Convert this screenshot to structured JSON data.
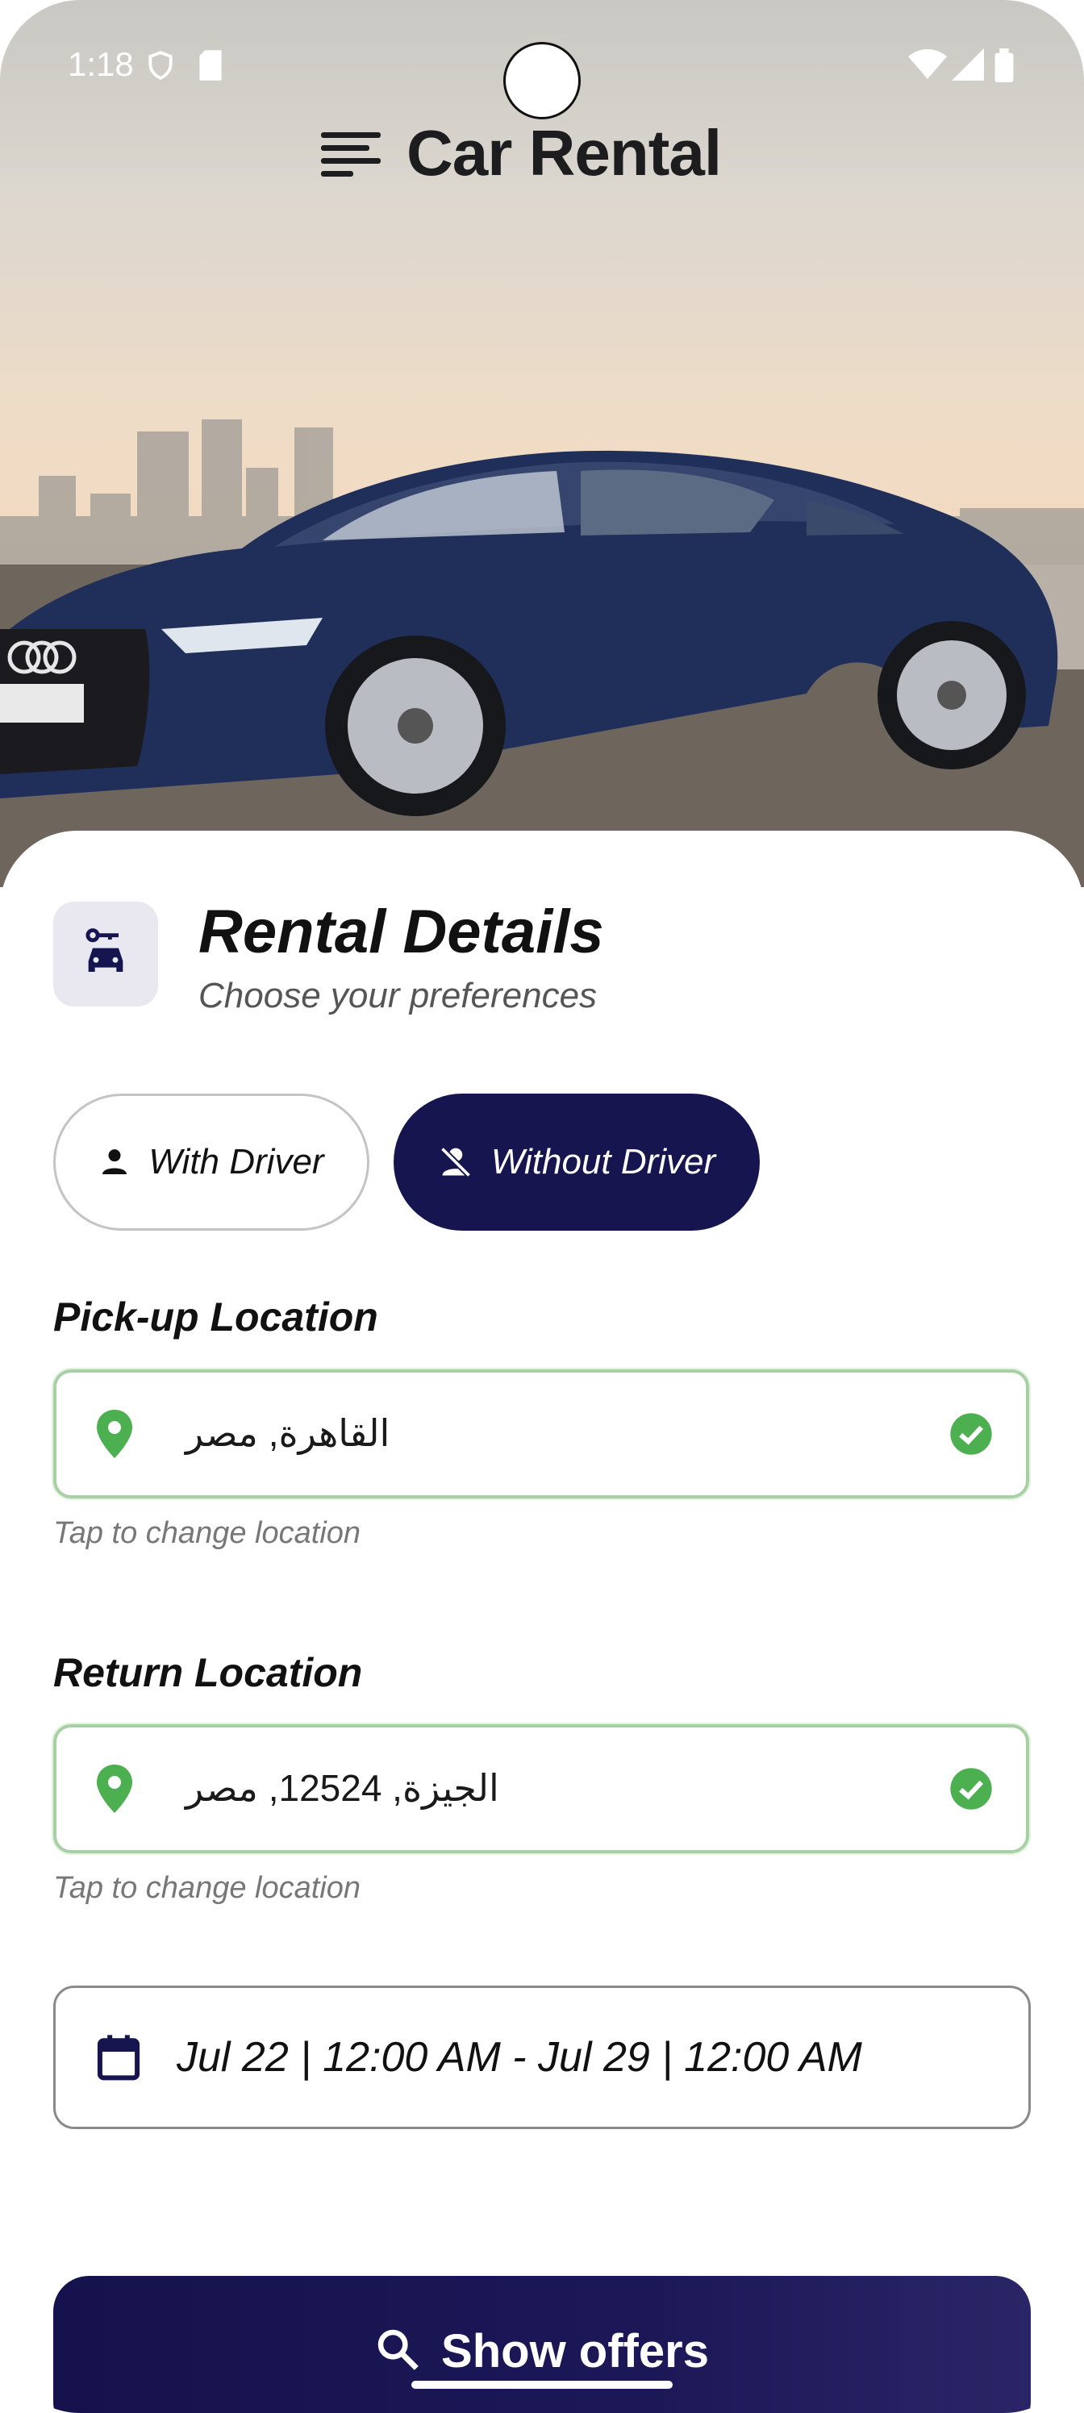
{
  "status_bar": {
    "time": "1:18"
  },
  "header": {
    "title": "Car Rental",
    "menu_icon": "menu-icon"
  },
  "hero": {
    "image": "car-photo"
  },
  "rental": {
    "title": "Rental Details",
    "subtitle": "Choose your preferences",
    "icon": "car-icon"
  },
  "driver_toggle": {
    "with_driver": "With Driver",
    "without_driver": "Without Driver",
    "selected": "Without Driver"
  },
  "pickup": {
    "label": "Pick-up Location",
    "value": "القاهرة, مصر",
    "helper": "Tap to change location"
  },
  "return": {
    "label": "Return Location",
    "value": "الجيزة, 12524, مصر",
    "helper": "Tap to change location"
  },
  "dates": {
    "value": "Jul 22 | 12:00 AM - Jul 29 | 12:00 AM"
  },
  "cta": {
    "label": "Show offers"
  },
  "colors": {
    "primary": "#17154f",
    "success": "#4caf50",
    "accent_bg": "#e9e7ef"
  }
}
